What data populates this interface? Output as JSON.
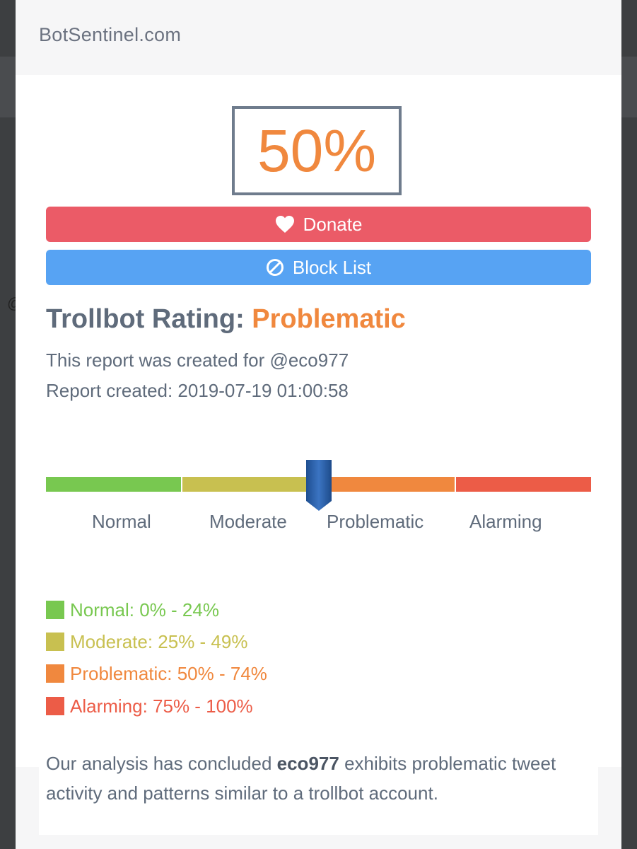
{
  "site": {
    "title": "BotSentinel.com"
  },
  "score": {
    "value": "50%"
  },
  "buttons": {
    "donate": "Donate",
    "block_list": "Block List"
  },
  "rating": {
    "heading": "Trollbot Rating:",
    "value": "Problematic",
    "report_for": "This report was created for @eco977",
    "created": "Report created: 2019-07-19 01:00:58"
  },
  "scale": {
    "level": 0.5,
    "labels": [
      "Normal",
      "Moderate",
      "Problematic",
      "Alarming"
    ],
    "colors": [
      "#78c850",
      "#c8c050",
      "#f0883e",
      "#ec5c47"
    ]
  },
  "legend": [
    {
      "text": "Normal: 0% - 24%",
      "color": "#78c850"
    },
    {
      "text": "Moderate: 25% - 49%",
      "color": "#c8c050"
    },
    {
      "text": "Problematic: 50% - 74%",
      "color": "#f0883e"
    },
    {
      "text": "Alarming: 75% - 100%",
      "color": "#ec5c47"
    }
  ],
  "conclusion": {
    "prefix": "Our analysis has concluded",
    "account": "eco977",
    "suffix": "exhibits problematic tweet activity and patterns similar to a trollbot account."
  },
  "icons": {
    "donate": "heart-icon",
    "block_list": "block-icon",
    "scale_marker": "marker-icon"
  }
}
